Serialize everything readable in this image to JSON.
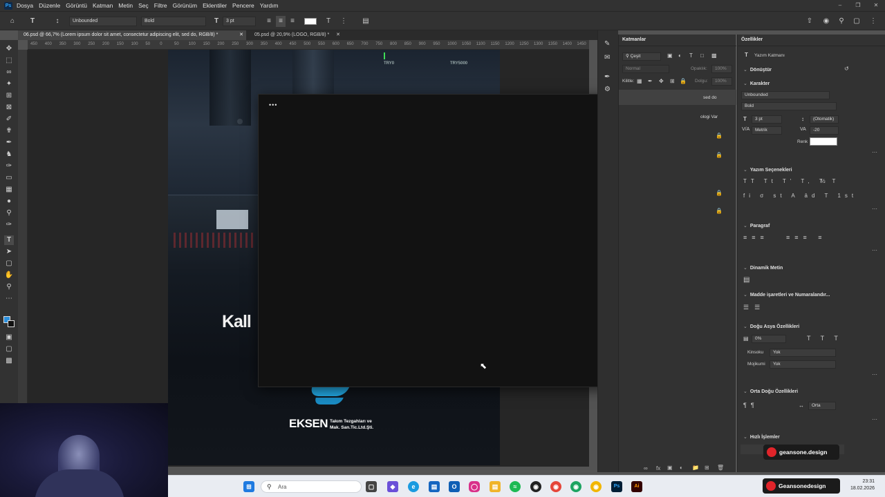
{
  "app": {
    "logo": "Ps",
    "menu": [
      "Dosya",
      "Düzenle",
      "Görüntü",
      "Katman",
      "Metin",
      "Seç",
      "Filtre",
      "Görünüm",
      "Eklentiler",
      "Pencere",
      "Yardım"
    ]
  },
  "options": {
    "font_family": "Unbounded",
    "font_style": "Bold",
    "font_size": "3 pt"
  },
  "tabs": [
    {
      "label": "06.psd @ 66,7% (Lorem ipsum dolor sit amet, consectetur adipiscing elit, sed do, RGB/8) *",
      "active": true
    },
    {
      "label": "05.psd @ 20,9% (LOGO, RGB/8) *",
      "active": false
    }
  ],
  "ruler": [
    "450",
    "400",
    "350",
    "300",
    "250",
    "200",
    "150",
    "100",
    "50",
    "0",
    "50",
    "100",
    "150",
    "200",
    "250",
    "300",
    "350",
    "400",
    "450",
    "500",
    "550",
    "600",
    "650",
    "700",
    "750",
    "800",
    "850",
    "900",
    "950",
    "1000",
    "1050",
    "1100",
    "1150",
    "1200",
    "1250",
    "1300",
    "1350",
    "1400",
    "1450"
  ],
  "artboard": {
    "top_label": "TRY0",
    "top_label_right": "TRY5000",
    "big_text": "Kall",
    "logo_text": "EKSEN",
    "logo_sub_1": "Takım Tezgahları ve",
    "logo_sub_2": "Mak. San.Tic.Ltd.Şti."
  },
  "dialog": {
    "menu_dots": "•••"
  },
  "layers": {
    "title": "Katmanlar",
    "filter": "Çeşit",
    "blend": "Normal",
    "opacity_label": "Opaklık:",
    "opacity_value": "100%",
    "lock_label": "Kilitle:",
    "fill_label": "Dolgu:",
    "fill_value": "100%",
    "row_text_1": "sed do",
    "row_text_2": "ologi Var"
  },
  "props": {
    "title": "Özellikler",
    "layer_type": "Yazım Katmanı",
    "sections": {
      "transform": "Dönüştür",
      "character": "Karakter",
      "type_options": "Yazım Seçenekleri",
      "paragraph": "Paragraf",
      "dynamic": "Dinamik Metin",
      "bullets": "Madde işaretleri ve Numaralandır...",
      "east_asian": "Doğu Asya Özellikleri",
      "middle_east": "Orta Doğu Özellikleri",
      "quick": "Hızlı İşlemler"
    },
    "font_family": "Unbounded",
    "font_style": "Bold",
    "font_size": "3 pt",
    "leading": "(Otomatik)",
    "kerning": "Metrik",
    "tracking": "-20",
    "color_label": "Renk",
    "tsume": "0%",
    "kinsoku_label": "Kinsoku",
    "kinsoku_value": "Yok",
    "mojikumi_label": "Mojikumi",
    "mojikumi_value": "Yok",
    "align_value": "Orta"
  },
  "badges": {
    "top": "geansone.design",
    "taskbar": "Geansonedesign"
  },
  "taskbar": {
    "search_placeholder": "Ara",
    "time": "23:31",
    "date": "18.02.2026"
  }
}
